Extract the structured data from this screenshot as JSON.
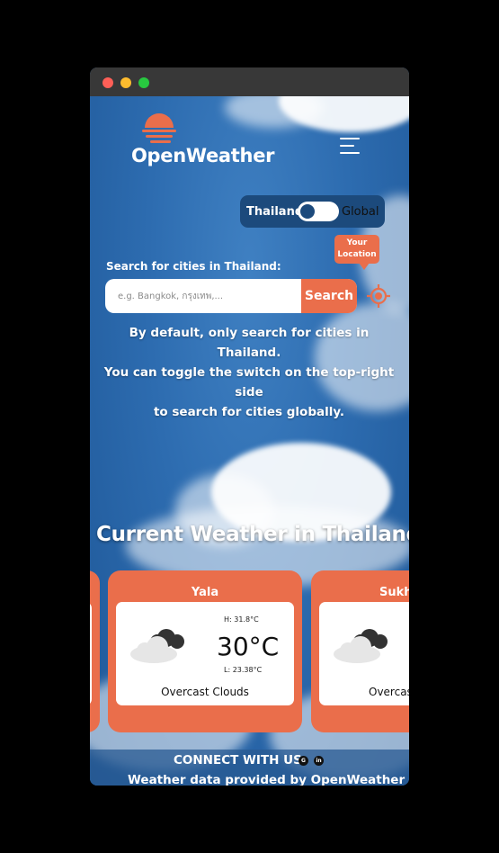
{
  "app": {
    "name": "OpenWeather"
  },
  "colors": {
    "accent": "#ea6e4b",
    "sky": "#2d6cb0",
    "toggle_bg": "#1c4a7c"
  },
  "toggle": {
    "left_label": "Thailand",
    "right_label": "Global",
    "state": "Thailand"
  },
  "location_tooltip": {
    "line1": "Your",
    "line2": "Location"
  },
  "search": {
    "title": "Search for cities in Thailand:",
    "placeholder": "e.g. Bangkok, กรุงเทพ,...",
    "value": "",
    "button_label": "Search"
  },
  "hint": {
    "line1": "By default, only search for cities in Thailand.",
    "line2": "You can toggle the switch on the top-right side",
    "line3": "to search for cities globally."
  },
  "current": {
    "title": "Current Weather in Thailand",
    "cards": [
      {
        "city": "Yala",
        "high": "H: 31.8°C",
        "temp": "30°C",
        "low": "L: 23.38°C",
        "desc": "Overcast Clouds",
        "icon": "overcast-clouds-icon"
      },
      {
        "city": "Sukhothai",
        "high": "",
        "temp": "",
        "low": "",
        "desc": "Overcast Clouds",
        "icon": "overcast-clouds-icon"
      }
    ]
  },
  "footer": {
    "connect": "CONNECT WITH US",
    "github_icon": "github-icon",
    "linkedin_icon": "linkedin-icon",
    "credit": "Weather data provided by OpenWeather"
  }
}
